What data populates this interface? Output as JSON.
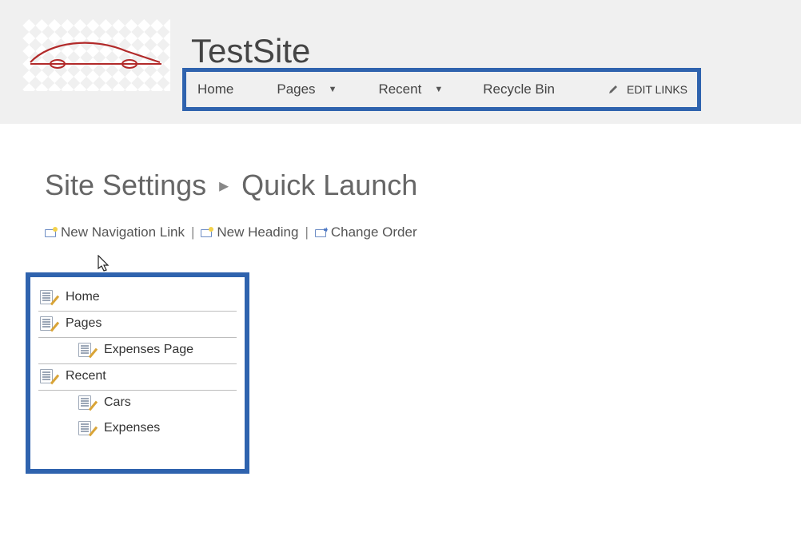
{
  "header": {
    "site_title": "TestSite",
    "nav": {
      "items": [
        {
          "label": "Home",
          "has_dropdown": false
        },
        {
          "label": "Pages",
          "has_dropdown": true
        },
        {
          "label": "Recent",
          "has_dropdown": true
        },
        {
          "label": "Recycle Bin",
          "has_dropdown": false
        }
      ],
      "edit_links_label": "EDIT LINKS"
    }
  },
  "breadcrumb": {
    "parent": "Site Settings",
    "current": "Quick Launch"
  },
  "actions": {
    "new_nav_link": "New Navigation Link",
    "new_heading": "New Heading",
    "change_order": "Change Order"
  },
  "quick_launch_tree": [
    {
      "label": "Home",
      "is_heading": true,
      "children": []
    },
    {
      "label": "Pages",
      "is_heading": true,
      "children": [
        {
          "label": "Expenses Page"
        }
      ]
    },
    {
      "label": "Recent",
      "is_heading": true,
      "children": [
        {
          "label": "Cars"
        },
        {
          "label": "Expenses"
        }
      ]
    }
  ],
  "colors": {
    "highlight_border": "#2f63ae",
    "logo_accent": "#b22a2a"
  }
}
